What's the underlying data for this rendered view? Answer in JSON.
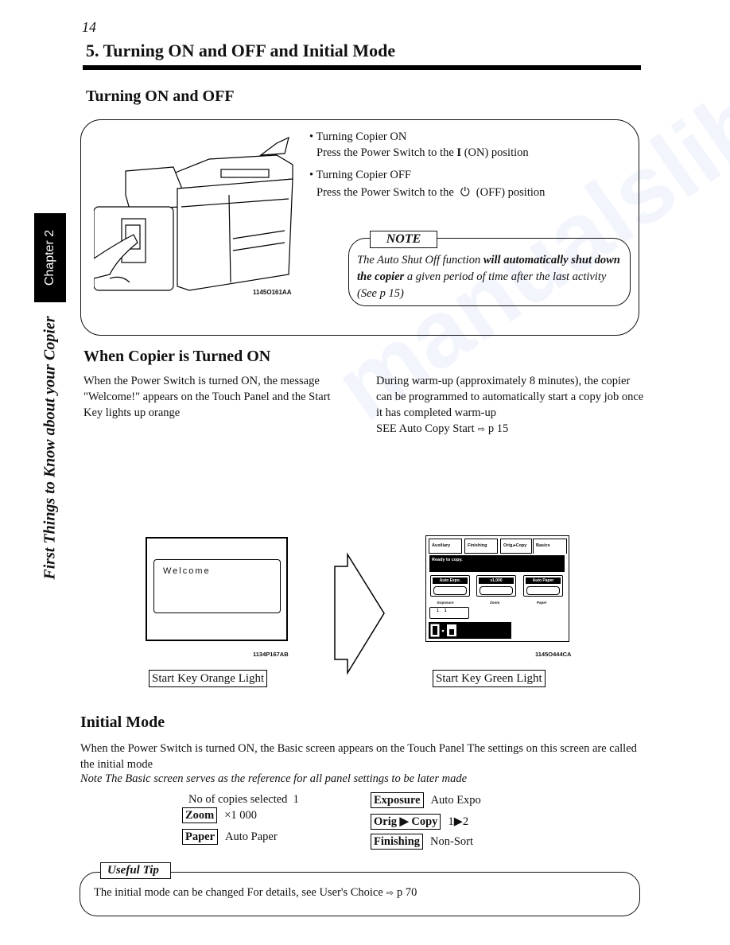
{
  "page": {
    "number": "14",
    "title": "5. Turning ON and OFF and Initial Mode",
    "chapter_tab": "Chapter 2",
    "side_title": "First Things to Know about your Copier",
    "watermark": "manualslib"
  },
  "section_on_off": {
    "heading": "Turning ON and OFF",
    "illustration_code": "1145O161AA",
    "bullets": [
      {
        "title": "• Turning Copier ON",
        "text_before": "Press the Power Switch to the ",
        "symbol": "I",
        "text_after": " (ON) position"
      },
      {
        "title": "• Turning Copier OFF",
        "text_before": "Press the Power Switch to the",
        "symbol": "⏻",
        "text_after": "(OFF) position"
      }
    ],
    "note": {
      "label": "NOTE",
      "text_1": "The Auto Shut Off function ",
      "text_bold_1": "will automatically shut down the copier",
      "text_2": " a given period of time after the last activity (See p  15)"
    }
  },
  "section_turned_on": {
    "heading": "When Copier is Turned ON",
    "left_paragraph": "When the Power Switch is turned ON, the message \"Welcome!\" appears on the Touch Panel and the Start Key lights up orange",
    "right_paragraph": "During warm-up (approximately 8 minutes), the copier can be programmed to automatically start a copy job once it has completed warm-up",
    "right_ref": {
      "text": "SEE Auto Copy Start",
      "arrow": "⇨",
      "page": "p  15"
    },
    "welcome_screen": {
      "message": "Welcome",
      "code": "1134P167AB",
      "start_key": "Start Key   Orange Light"
    },
    "basic_screen": {
      "tabs": [
        "Auxiliary",
        "Finishing",
        "Orig.▸Copy",
        "Basics"
      ],
      "message": "Ready to copy.",
      "buttons": [
        {
          "header": "Auto Expo.",
          "caption": "Exposure"
        },
        {
          "header": "x1.000",
          "caption": "Zoom"
        },
        {
          "header": "Auto Paper",
          "caption": "Paper"
        }
      ],
      "counter": "1     1",
      "code": "1145O444CA",
      "start_key": "Start Key   Green Light"
    }
  },
  "section_initial_mode": {
    "heading": "Initial Mode",
    "paragraph": "When the Power Switch is turned ON, the Basic screen appears on the Touch Panel  The settings on this screen are called the initial mode",
    "note": "Note  The Basic screen serves as the reference for all panel settings to be later made",
    "settings_left": [
      {
        "key": "",
        "label": "No  of copies selected",
        "value": "1"
      },
      {
        "key": "Zoom",
        "value": "×1 000"
      },
      {
        "key": "Paper",
        "value": "Auto Paper"
      }
    ],
    "settings_right": [
      {
        "key": "Exposure",
        "value": "Auto Expo"
      },
      {
        "key": "Orig ▶ Copy",
        "value": "1▶2"
      },
      {
        "key": "Finishing",
        "value": "Non-Sort"
      }
    ],
    "tip": {
      "label": "Useful Tip",
      "text": "The initial mode can be changed  For details, see User's Choice",
      "arrow": "⇨",
      "page": "p  70"
    }
  }
}
